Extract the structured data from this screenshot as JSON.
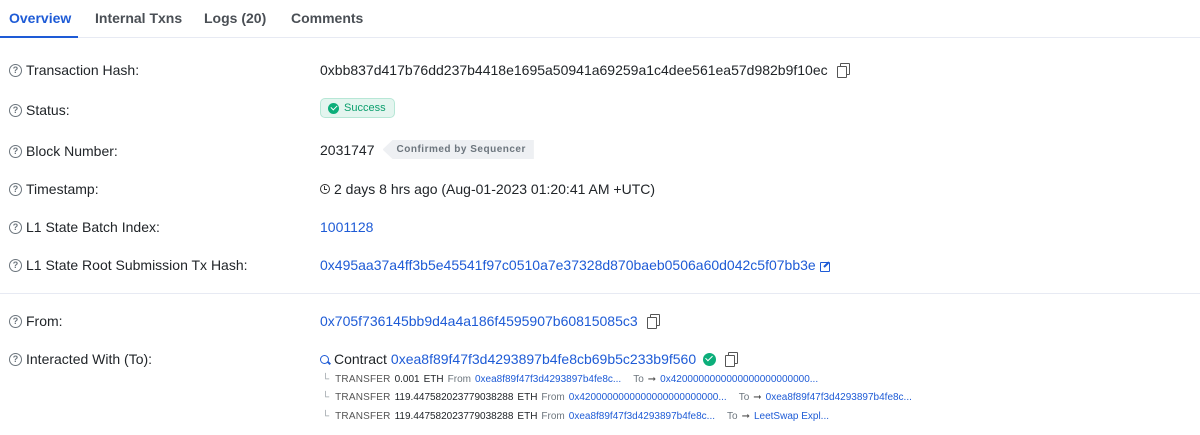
{
  "tabs": [
    {
      "label": "Overview",
      "active": true
    },
    {
      "label": "Internal Txns",
      "active": false
    },
    {
      "label": "Logs (20)",
      "active": false
    },
    {
      "label": "Comments",
      "active": false
    }
  ],
  "rows": {
    "tx_hash": {
      "label": "Transaction Hash:",
      "value": "0xbb837d417b76dd237b4418e1695a50941a69259a1c4dee561ea57d982b9f10ec"
    },
    "status": {
      "label": "Status:",
      "value": "Success"
    },
    "block": {
      "label": "Block Number:",
      "value": "2031747",
      "tag": "Confirmed by Sequencer"
    },
    "timestamp": {
      "label": "Timestamp:",
      "value": "2 days 8 hrs ago (Aug-01-2023 01:20:41 AM +UTC)"
    },
    "batch_index": {
      "label": "L1 State Batch Index:",
      "value": "1001128"
    },
    "root_submission": {
      "label": "L1 State Root Submission Tx Hash:",
      "value": "0x495aa37a4ff3b5e45541f97c0510a7e37328d870baeb0506a60d042c5f07bb3e"
    },
    "from": {
      "label": "From:",
      "value": "0x705f736145bb9d4a4a186f4595907b60815085c3"
    },
    "interacted": {
      "label": "Interacted With (To):",
      "prefix": "Contract",
      "value": "0xea8f89f47f3d4293897b4fe8cb69b5c233b9f560"
    }
  },
  "transfers": [
    {
      "elbow": "└",
      "kind": "TRANSFER",
      "amount": "0.001",
      "unit": "ETH",
      "from_label": "From",
      "from": "0xea8f89f47f3d4293897b4fe8c...",
      "to_label": "To",
      "arrow": "➞",
      "to": "0x4200000000000000000000000..."
    },
    {
      "elbow": "└",
      "kind": "TRANSFER",
      "amount": "119.447582023779038288",
      "unit": "ETH",
      "from_label": "From",
      "from": "0x4200000000000000000000000...",
      "to_label": "To",
      "arrow": "➞",
      "to": "0xea8f89f47f3d4293897b4fe8c..."
    },
    {
      "elbow": "└",
      "kind": "TRANSFER",
      "amount": "119.447582023779038288",
      "unit": "ETH",
      "from_label": "From",
      "from": "0xea8f89f47f3d4293897b4fe8c...",
      "to_label": "To",
      "arrow": "➞",
      "to": "LeetSwap Expl..."
    }
  ],
  "colors": {
    "accent": "#1e5bd6",
    "success": "#0cae7a"
  },
  "icons": [
    "question-icon",
    "copy-icon",
    "check-circle-icon",
    "clock-icon",
    "external-link-icon",
    "search-icon",
    "verified-icon"
  ]
}
